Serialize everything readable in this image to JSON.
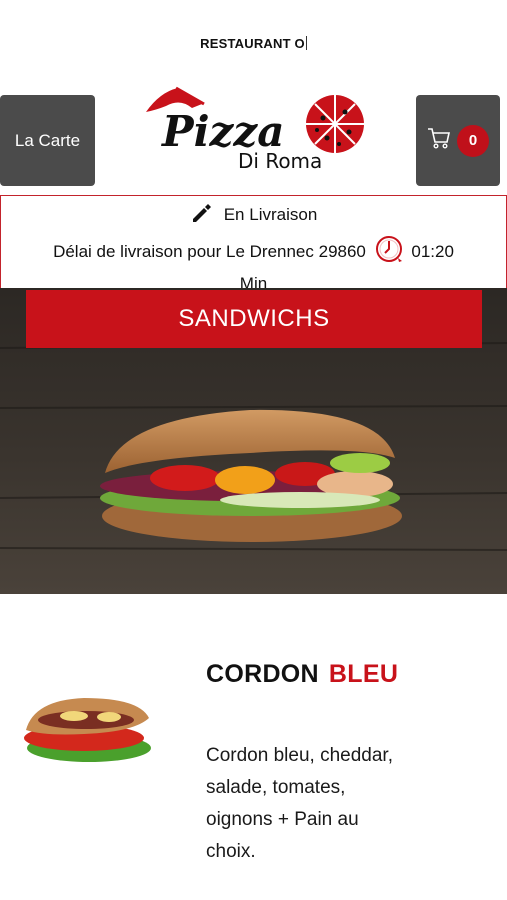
{
  "header": {
    "restaurant_name": "RESTAURANT O",
    "menu_button_label": "La Carte",
    "cart_count": "0"
  },
  "logo": {
    "brand": "Pizza",
    "subtitle": "Di Roma"
  },
  "delivery": {
    "mode": "En Livraison",
    "delay_text": "Délai de livraison pour Le Drennec 29860",
    "time": "01:20",
    "unit": "Min"
  },
  "category": {
    "title": "SANDWICHS"
  },
  "product": {
    "name_part1": "CORDON",
    "name_part2": "BLEU",
    "description": "Cordon bleu, cheddar, salade, tomates, oignons + Pain au choix."
  },
  "colors": {
    "accent_red": "#c8121a",
    "button_gray": "#4b4b4b"
  }
}
